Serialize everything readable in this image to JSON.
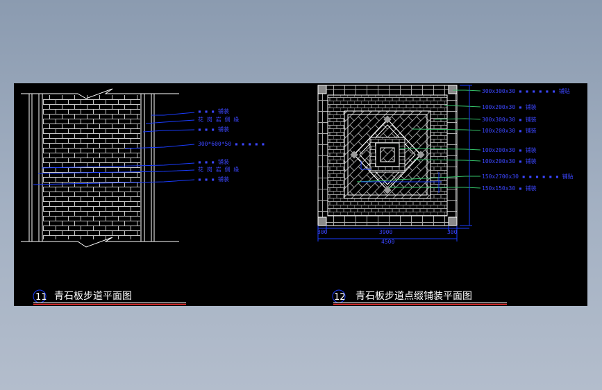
{
  "drawing1": {
    "number": "11",
    "title": "青石板步道平面图",
    "callouts": [
      "▪ ▪ ▪ 铺装",
      "花 岗 岩 侧 缘",
      "▪ ▪ ▪ 铺装",
      "300*600*50 ▪ ▪ ▪ ▪ ▪",
      "▪ ▪ ▪ 铺装",
      "花 岗 岩 侧 缘",
      "▪ ▪ ▪ 铺装"
    ]
  },
  "drawing2": {
    "number": "12",
    "title": "青石板步道点缀铺装平面图",
    "callouts": [
      "300x300x30 ▪ ▪ ▪ ▪ ▪ ▪ 铺贴",
      "100x200x30 ▪ 铺装",
      "300x300x30 ▪ 铺装",
      "100x200x30 ▪ 铺装",
      "100x200x30 ▪ 铺装",
      "100x200x30 ▪ 铺装",
      "150x2700x30 ▪ ▪ ▪ ▪ ▪ ▪ 铺贴",
      "150x150x30 ▪ 铺装"
    ],
    "dims": {
      "left": "300",
      "center": "3900",
      "right": "300",
      "total": "4500"
    }
  },
  "colors": {
    "sheet": "#000000",
    "linework": "#ffffff",
    "pattern": "#b9b9b9",
    "leader_blue": "#1a3cff",
    "leader_green": "#35c46a",
    "text_blue": "#3b46ff",
    "title_red": "#ff3030"
  }
}
